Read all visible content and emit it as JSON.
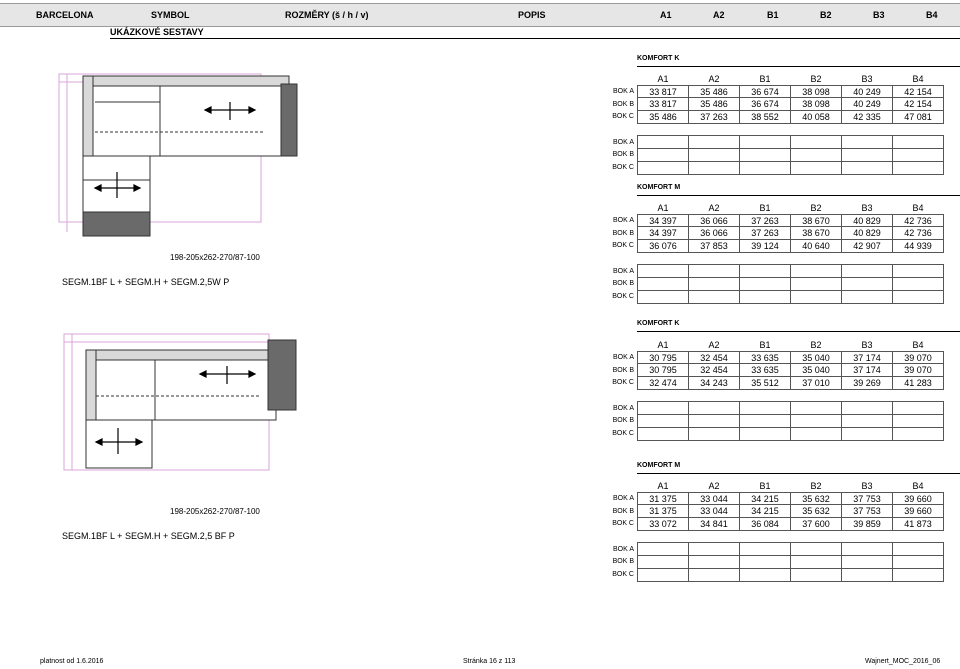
{
  "header": {
    "columns": [
      "BARCELONA",
      "SYMBOL",
      "ROZMĚRY (š / h / v)",
      "POPIS",
      "A1",
      "A2",
      "B1",
      "B2",
      "B3",
      "B4"
    ]
  },
  "subtitle": "UKÁZKOVÉ SESTAVY",
  "sets": [
    {
      "dimensions": "198-205x262-270/87-100",
      "name": "SEGM.1BF L + SEGM.H + SEGM.2,5W P",
      "tables": [
        {
          "title": "KOMFORT K",
          "columns": [
            "A1",
            "A2",
            "B1",
            "B2",
            "B3",
            "B4"
          ],
          "rows": [
            {
              "label": "BOK A",
              "values": [
                "33 817",
                "35 486",
                "36 674",
                "38 098",
                "40 249",
                "42 154"
              ]
            },
            {
              "label": "BOK B",
              "values": [
                "33 817",
                "35 486",
                "36 674",
                "38 098",
                "40 249",
                "42 154"
              ]
            },
            {
              "label": "BOK C",
              "values": [
                "35 486",
                "37 263",
                "38 552",
                "40 058",
                "42 335",
                "47 081"
              ]
            }
          ],
          "empty_rows": [
            "BOK A",
            "BOK B",
            "BOK C"
          ]
        },
        {
          "title": "KOMFORT M",
          "columns": [
            "A1",
            "A2",
            "B1",
            "B2",
            "B3",
            "B4"
          ],
          "rows": [
            {
              "label": "BOK A",
              "values": [
                "34 397",
                "36 066",
                "37 263",
                "38 670",
                "40 829",
                "42 736"
              ]
            },
            {
              "label": "BOK B",
              "values": [
                "34 397",
                "36 066",
                "37 263",
                "38 670",
                "40 829",
                "42 736"
              ]
            },
            {
              "label": "BOK C",
              "values": [
                "36 076",
                "37 853",
                "39 124",
                "40 640",
                "42 907",
                "44 939"
              ]
            }
          ],
          "empty_rows": [
            "BOK A",
            "BOK B",
            "BOK C"
          ]
        }
      ]
    },
    {
      "dimensions": "198-205x262-270/87-100",
      "name": "SEGM.1BF L + SEGM.H + SEGM.2,5 BF P",
      "tables": [
        {
          "title": "KOMFORT K",
          "columns": [
            "A1",
            "A2",
            "B1",
            "B2",
            "B3",
            "B4"
          ],
          "rows": [
            {
              "label": "BOK A",
              "values": [
                "30 795",
                "32 454",
                "33 635",
                "35 040",
                "37 174",
                "39 070"
              ]
            },
            {
              "label": "BOK B",
              "values": [
                "30 795",
                "32 454",
                "33 635",
                "35 040",
                "37 174",
                "39 070"
              ]
            },
            {
              "label": "BOK C",
              "values": [
                "32 474",
                "34 243",
                "35 512",
                "37 010",
                "39 269",
                "41 283"
              ]
            }
          ],
          "empty_rows": [
            "BOK A",
            "BOK B",
            "BOK C"
          ]
        },
        {
          "title": "KOMFORT M",
          "columns": [
            "A1",
            "A2",
            "B1",
            "B2",
            "B3",
            "B4"
          ],
          "rows": [
            {
              "label": "BOK A",
              "values": [
                "31 375",
                "33 044",
                "34 215",
                "35 632",
                "37 753",
                "39 660"
              ]
            },
            {
              "label": "BOK B",
              "values": [
                "31 375",
                "33 044",
                "34 215",
                "35 632",
                "37 753",
                "39 660"
              ]
            },
            {
              "label": "BOK C",
              "values": [
                "33 072",
                "34 841",
                "36 084",
                "37 600",
                "39 859",
                "41 873"
              ]
            }
          ],
          "empty_rows": [
            "BOK A",
            "BOK B",
            "BOK C"
          ]
        }
      ]
    }
  ],
  "footer": {
    "valid_from": "platnost od 1.6.2016",
    "page": "Stránka 16 z 113",
    "doc_code": "Wajnert_MOC_2016_06"
  },
  "colors": {
    "header_bg": "#e6e6e6",
    "outline_pink": "#d9a6d9",
    "sofa_dark": "#6a6a6a",
    "sofa_line": "#333333"
  }
}
